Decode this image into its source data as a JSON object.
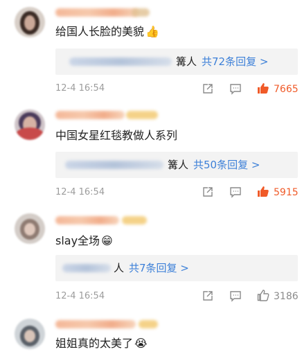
{
  "comments": [
    {
      "text": "给国人长脸的美貌",
      "emoji": "👍",
      "reply_tail": "篝人",
      "reply_link": "共72条回复 >",
      "time": "12-4 16:54",
      "likes": "7665",
      "liked": true
    },
    {
      "text": "中国女星红毯教做人系列",
      "emoji": "",
      "reply_tail": "篝人",
      "reply_link": "共50条回复 >",
      "time": "12-4 16:54",
      "likes": "5915",
      "liked": true
    },
    {
      "text": "slay全场",
      "emoji": "😁",
      "reply_tail": "人",
      "reply_link": "共7条回复 >",
      "time": "12-4 16:54",
      "likes": "3186",
      "liked": false
    },
    {
      "text": "姐姐真的太美了",
      "emoji": "😭",
      "time": "",
      "likes": "",
      "liked": false
    }
  ],
  "icons": {
    "share": "share-icon",
    "comment": "comment-icon",
    "like": "thumbs-up-icon"
  },
  "colors": {
    "liked": "#f05a28",
    "link": "#3d80d8",
    "muted": "#9c9c9c"
  }
}
